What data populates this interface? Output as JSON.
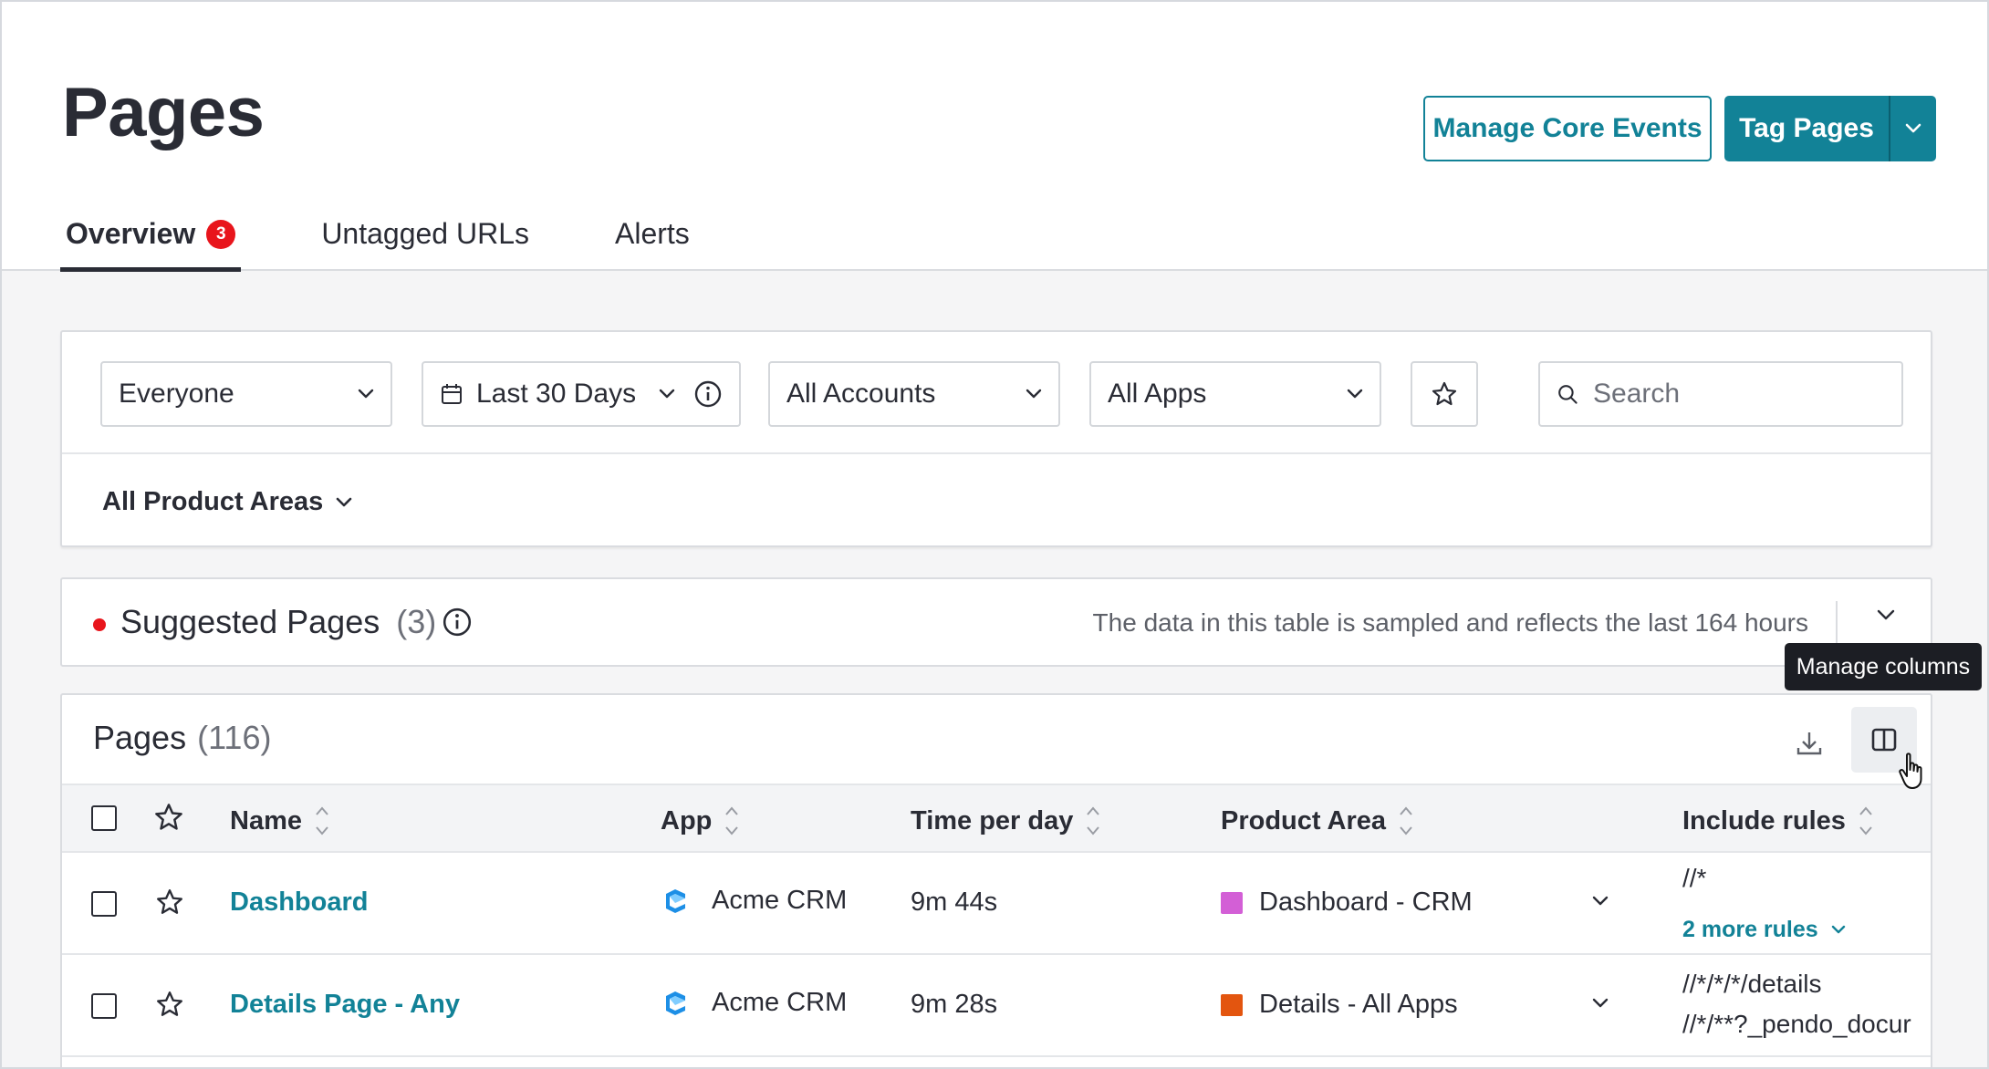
{
  "header": {
    "title": "Pages",
    "manage_core_events": "Manage Core Events",
    "tag_pages": "Tag Pages"
  },
  "tabs": [
    {
      "label": "Overview",
      "badge": "3",
      "active": true
    },
    {
      "label": "Untagged URLs",
      "active": false
    },
    {
      "label": "Alerts",
      "active": false
    }
  ],
  "filters": {
    "segment": "Everyone",
    "date_range": "Last 30 Days",
    "accounts": "All Accounts",
    "apps": "All Apps",
    "search_placeholder": "Search",
    "product_areas": "All Product Areas"
  },
  "suggested": {
    "title": "Suggested Pages",
    "count": "(3)",
    "note": "The data in this table is sampled and reflects the last 164 hours"
  },
  "tooltip": "Manage columns",
  "table": {
    "title": "Pages",
    "count": "(116)",
    "columns": [
      "Name",
      "App",
      "Time per day",
      "Product Area",
      "Include rules"
    ],
    "rows": [
      {
        "name": "Dashboard",
        "app": "Acme CRM",
        "time_per_day": "9m 44s",
        "product_area": "Dashboard - CRM",
        "product_area_color": "#d35fd6",
        "rules": [
          "//*"
        ],
        "more_rules": "2 more rules"
      },
      {
        "name": "Details Page - Any",
        "app": "Acme CRM",
        "time_per_day": "9m 28s",
        "product_area": "Details - All Apps",
        "product_area_color": "#e3550f",
        "rules": [
          "//*/*/*/details",
          "//*/**?_pendo_docur"
        ]
      }
    ]
  },
  "colors": {
    "accent": "#128297",
    "alert": "#e8151c",
    "text": "#2a2c35"
  }
}
